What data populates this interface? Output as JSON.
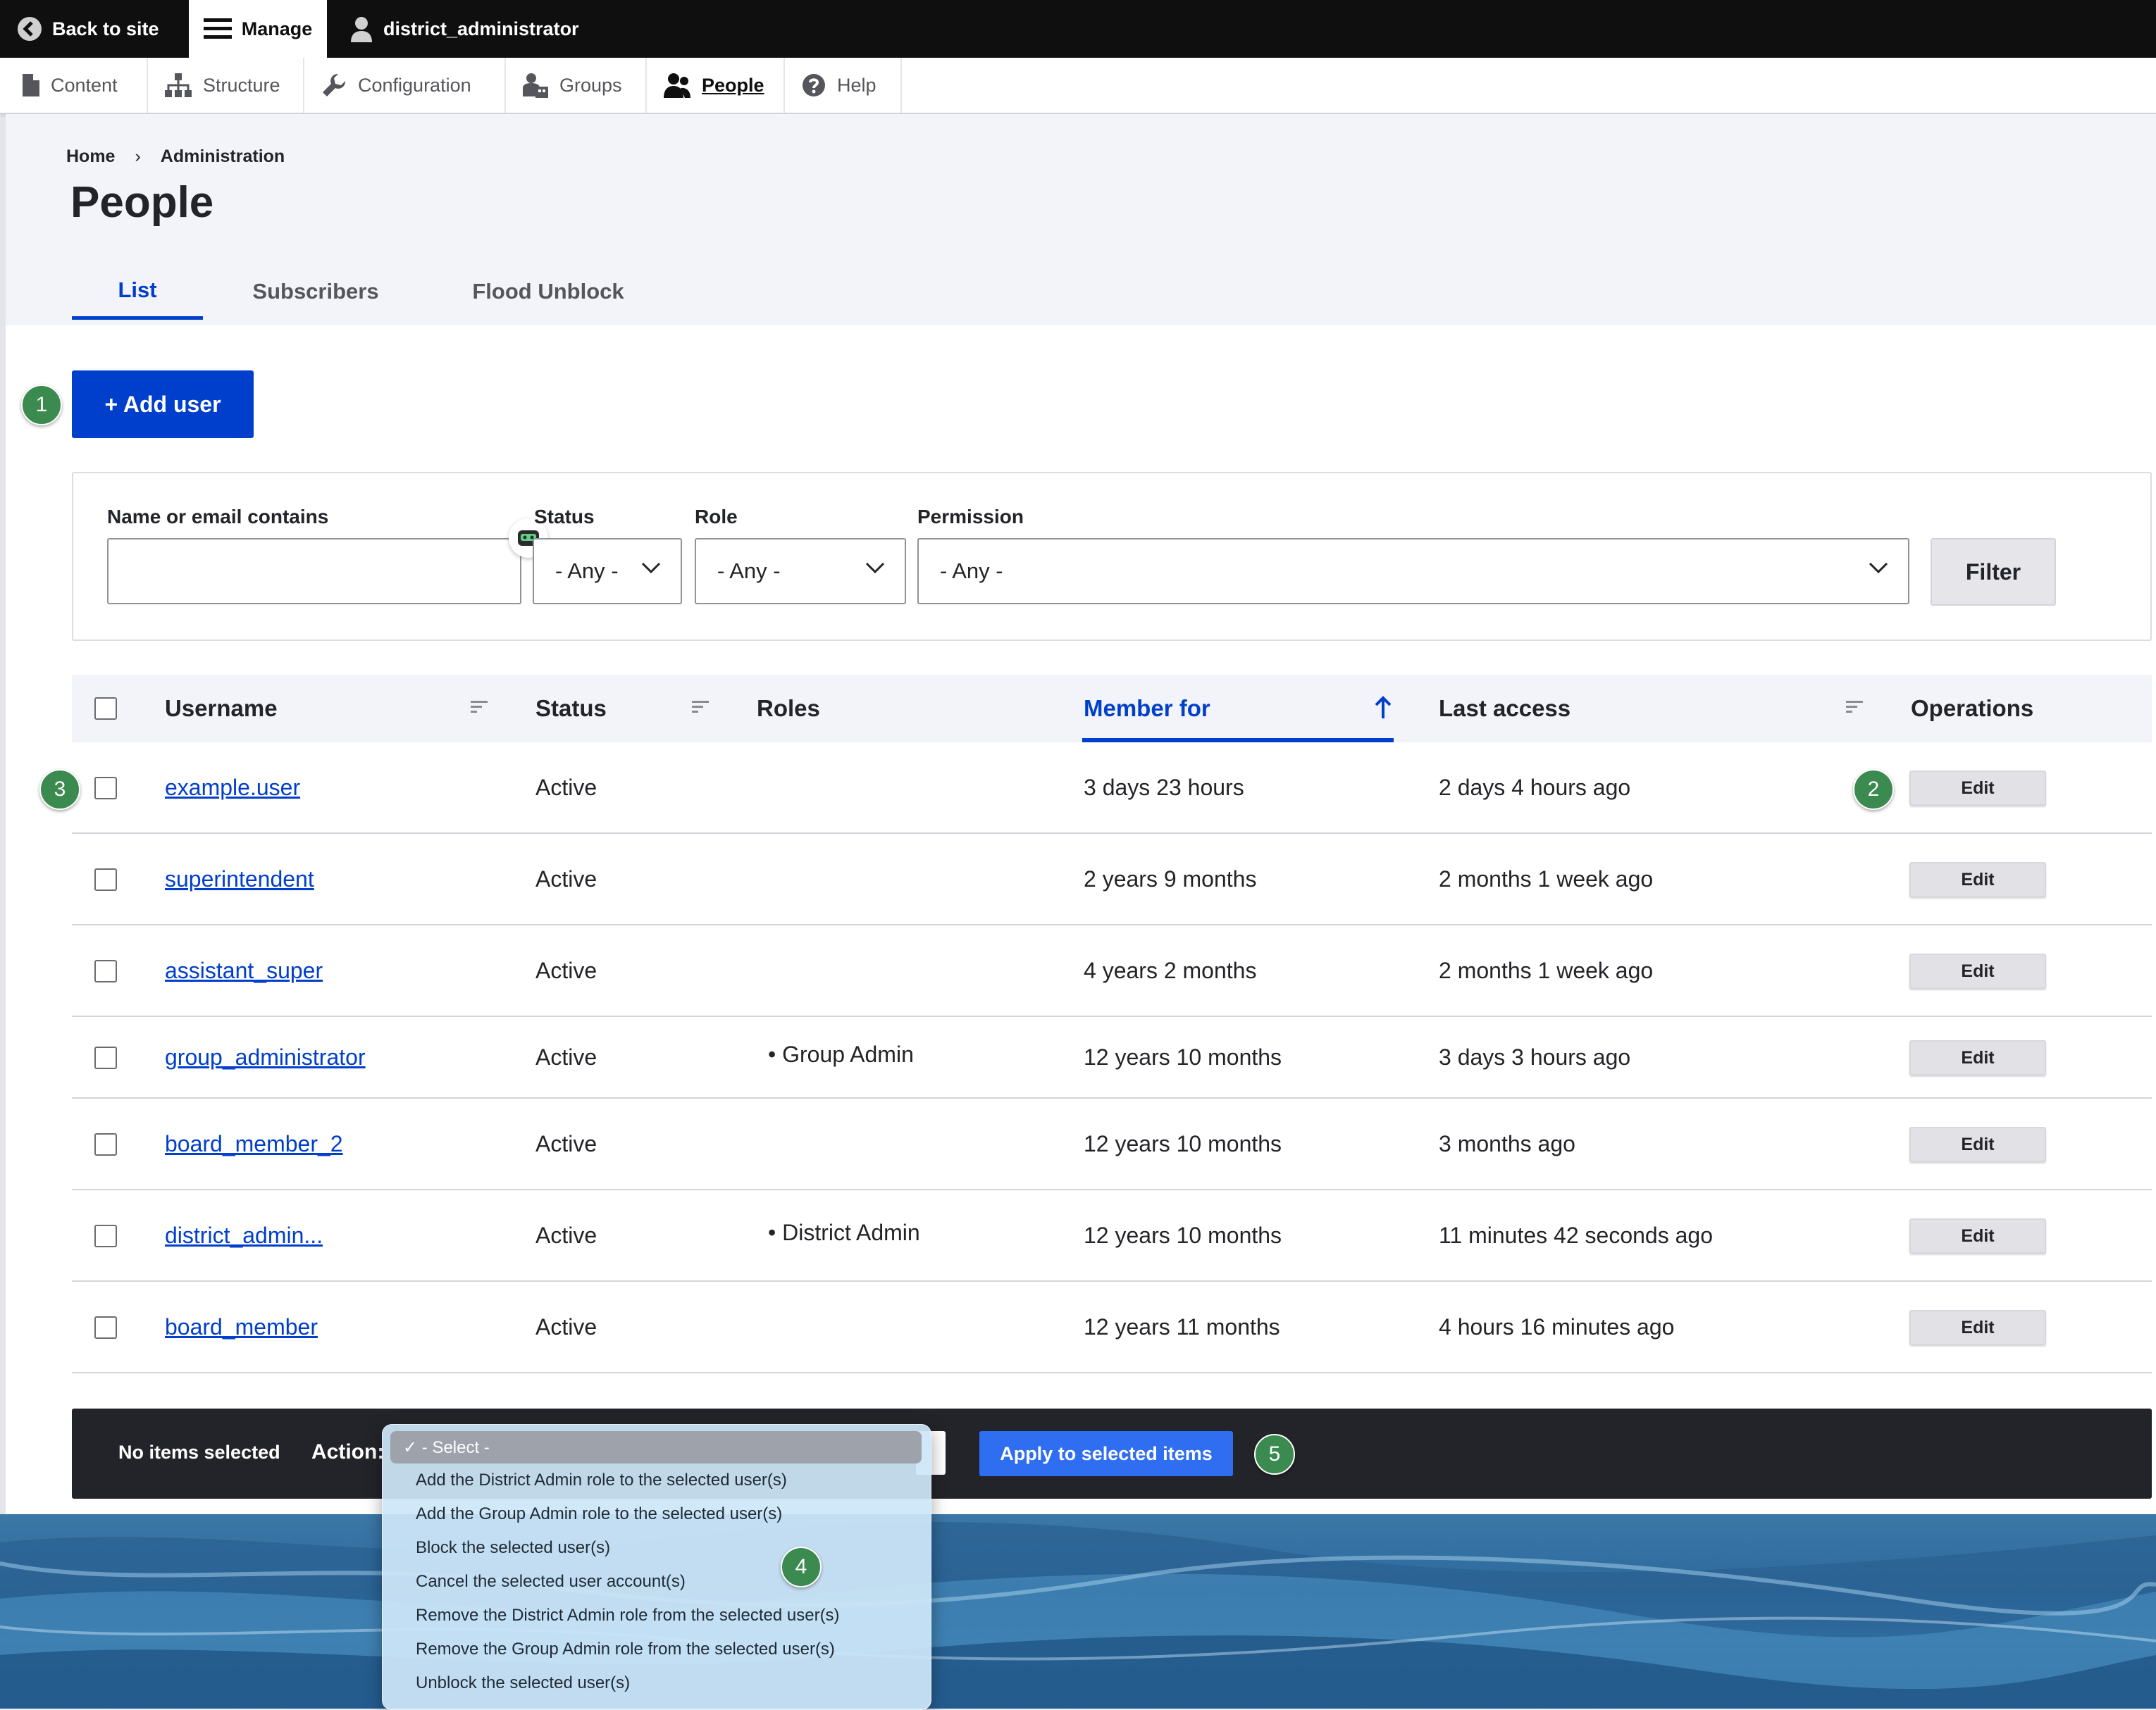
{
  "toolbar": {
    "back": "Back to site",
    "manage": "Manage",
    "user": "district_administrator"
  },
  "tray": [
    {
      "label": "Content",
      "icon": "file-icon"
    },
    {
      "label": "Structure",
      "icon": "sitemap-icon"
    },
    {
      "label": "Configuration",
      "icon": "wrench-icon"
    },
    {
      "label": "Groups",
      "icon": "group-icon"
    },
    {
      "label": "People",
      "icon": "people-icon",
      "active": true
    },
    {
      "label": "Help",
      "icon": "help-icon"
    }
  ],
  "breadcrumb": [
    "Home",
    "Administration"
  ],
  "page_title": "People",
  "tabs": [
    "List",
    "Subscribers",
    "Flood Unblock"
  ],
  "add_user": "+ Add user",
  "badges": [
    "1",
    "2",
    "3",
    "4",
    "5"
  ],
  "filters": {
    "name_label": "Name or email contains",
    "name_value": "",
    "status_label": "Status",
    "status_value": "- Any -",
    "role_label": "Role",
    "role_value": "- Any -",
    "permission_label": "Permission",
    "permission_value": "- Any -",
    "filter_button": "Filter"
  },
  "table": {
    "headers": {
      "username": "Username",
      "status": "Status",
      "roles": "Roles",
      "member_for": "Member for",
      "last_access": "Last access",
      "operations": "Operations"
    },
    "sorted_column": "Member for",
    "rows": [
      {
        "username": "example.user",
        "status": "Active",
        "role": "",
        "member_for": "3 days 23 hours",
        "last_access": "2 days 4 hours ago",
        "op": "Edit"
      },
      {
        "username": "superintendent",
        "status": "Active",
        "role": "",
        "member_for": "2 years 9 months",
        "last_access": "2 months 1 week ago",
        "op": "Edit"
      },
      {
        "username": "assistant_super",
        "status": "Active",
        "role": "",
        "member_for": "4 years 2 months",
        "last_access": "2 months 1 week ago",
        "op": "Edit"
      },
      {
        "username": "group_administrator",
        "status": "Active",
        "role": "• Group Admin",
        "member_for": "12 years 10 months",
        "last_access": "3 days 3 hours ago",
        "op": "Edit"
      },
      {
        "username": "board_member_2",
        "status": "Active",
        "role": "",
        "member_for": "12 years 10 months",
        "last_access": "3 months ago",
        "op": "Edit"
      },
      {
        "username": "district_admin...",
        "status": "Active",
        "role": "• District Admin",
        "member_for": "12 years 10 months",
        "last_access": "11 minutes 42 seconds ago",
        "op": "Edit"
      },
      {
        "username": "board_member",
        "status": "Active",
        "role": "",
        "member_for": "12 years 11 months",
        "last_access": "4 hours 16 minutes ago",
        "op": "Edit"
      }
    ]
  },
  "bulk": {
    "status": "No items selected",
    "action_label": "Action:",
    "apply": "Apply to selected items",
    "selected_option": "✓ - Select -",
    "options": [
      "Add the District Admin role to the selected user(s)",
      "Add the Group Admin role to the selected user(s)",
      "Block the selected user(s)",
      "Cancel the selected user account(s)",
      "Remove the District Admin role from the selected user(s)",
      "Remove the Group Admin role from the selected user(s)",
      "Unblock the selected user(s)"
    ]
  },
  "colors": {
    "accent": "#003ecc",
    "badge": "#3b8a4f",
    "toolbar": "#0f0f0f"
  }
}
